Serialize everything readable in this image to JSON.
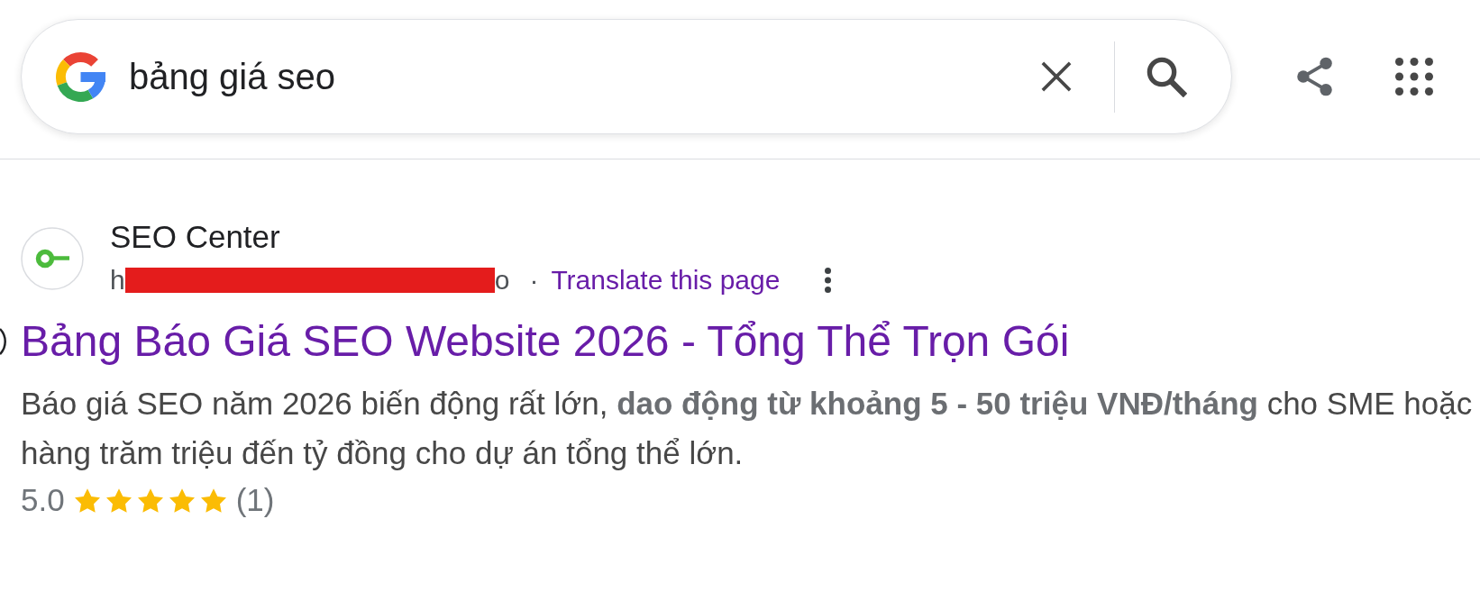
{
  "search_bar": {
    "query": "bảng giá seo"
  },
  "result": {
    "site_name": "SEO Center",
    "url_start": "h",
    "url_redacted": true,
    "url_end": "o",
    "separator": "·",
    "translate_link": "Translate this page",
    "title": "Bảng Báo Giá SEO Website 2026 - Tổng Thể Trọn Gói",
    "snippet": "Báo giá SEO năm 2026 biến động rất lớn, **dao động từ khoảng 5 - 50 triệu VNĐ/tháng** cho SME hoặc hàng trăm triệu đến tỷ đồng cho dự án tổng thể lớn.",
    "rating": "5.0",
    "stars": 5,
    "review_count": "(1)"
  }
}
